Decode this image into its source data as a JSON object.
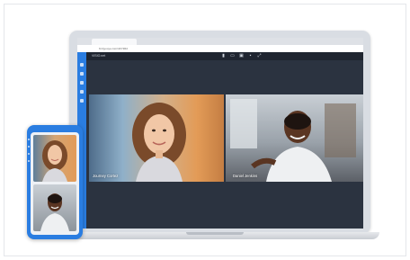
{
  "browser": {
    "tab_title": "",
    "url": "bt.bjyooye.com/4AY3Rd"
  },
  "app": {
    "title": "VISIO.net"
  },
  "participants": [
    {
      "name": "Journey Cortez"
    },
    {
      "name": "Daniel Jenkins"
    }
  ],
  "colors": {
    "accent": "#2a7de1",
    "app_bar": "#1f2530",
    "screen_bg": "#2b3340"
  },
  "icons": {
    "mic": "mic-icon",
    "camera": "camera-icon",
    "screen_share": "screen-share-icon",
    "settings": "settings-icon",
    "expand": "expand-icon"
  }
}
